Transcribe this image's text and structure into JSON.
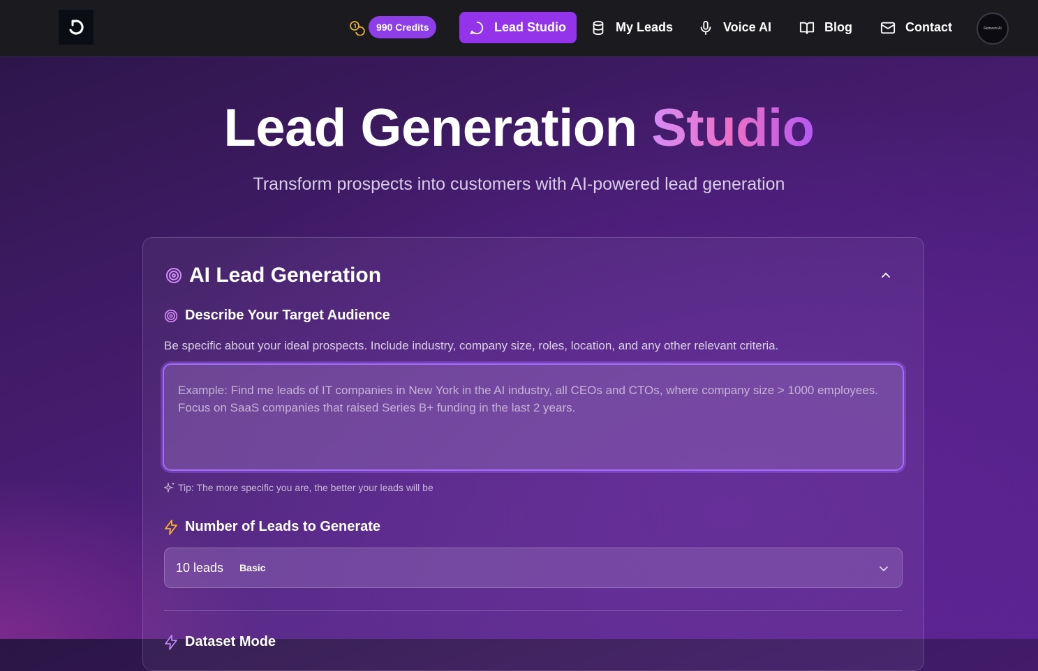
{
  "nav": {
    "credits": "990 Credits",
    "items": [
      {
        "label": "Lead Studio",
        "icon": "chat-bubble-icon",
        "active": true
      },
      {
        "label": "My Leads",
        "icon": "database-icon"
      },
      {
        "label": "Voice AI",
        "icon": "microphone-icon"
      },
      {
        "label": "Blog",
        "icon": "book-icon"
      },
      {
        "label": "Contact",
        "icon": "mail-icon"
      }
    ],
    "avatar_text": "Reinvent AI"
  },
  "hero": {
    "title_main": "Lead Generation",
    "title_accent": "Studio",
    "subtitle": "Transform prospects into customers with AI-powered lead generation"
  },
  "card": {
    "title": "AI Lead Generation",
    "audience": {
      "label": "Describe Your Target Audience",
      "helper": "Be specific about your ideal prospects. Include industry, company size, roles, location, and any other relevant criteria.",
      "placeholder": "Example: Find me leads of IT companies in New York in the AI industry, all CEOs and CTOs, where company size > 1000 employees. Focus on SaaS companies that raised Series B+ funding in the last 2 years.",
      "value": "",
      "tip": "Tip: The more specific you are, the better your leads will be"
    },
    "lead_count": {
      "label": "Number of Leads to Generate",
      "selected": "10 leads",
      "badge": "Basic"
    },
    "next_section_label": "Dataset Mode"
  },
  "colors": {
    "accent": "#9333ea",
    "credits_pill": "#8e3ee6",
    "focus_border": "#a66bff",
    "lightning": "#f5b731"
  }
}
